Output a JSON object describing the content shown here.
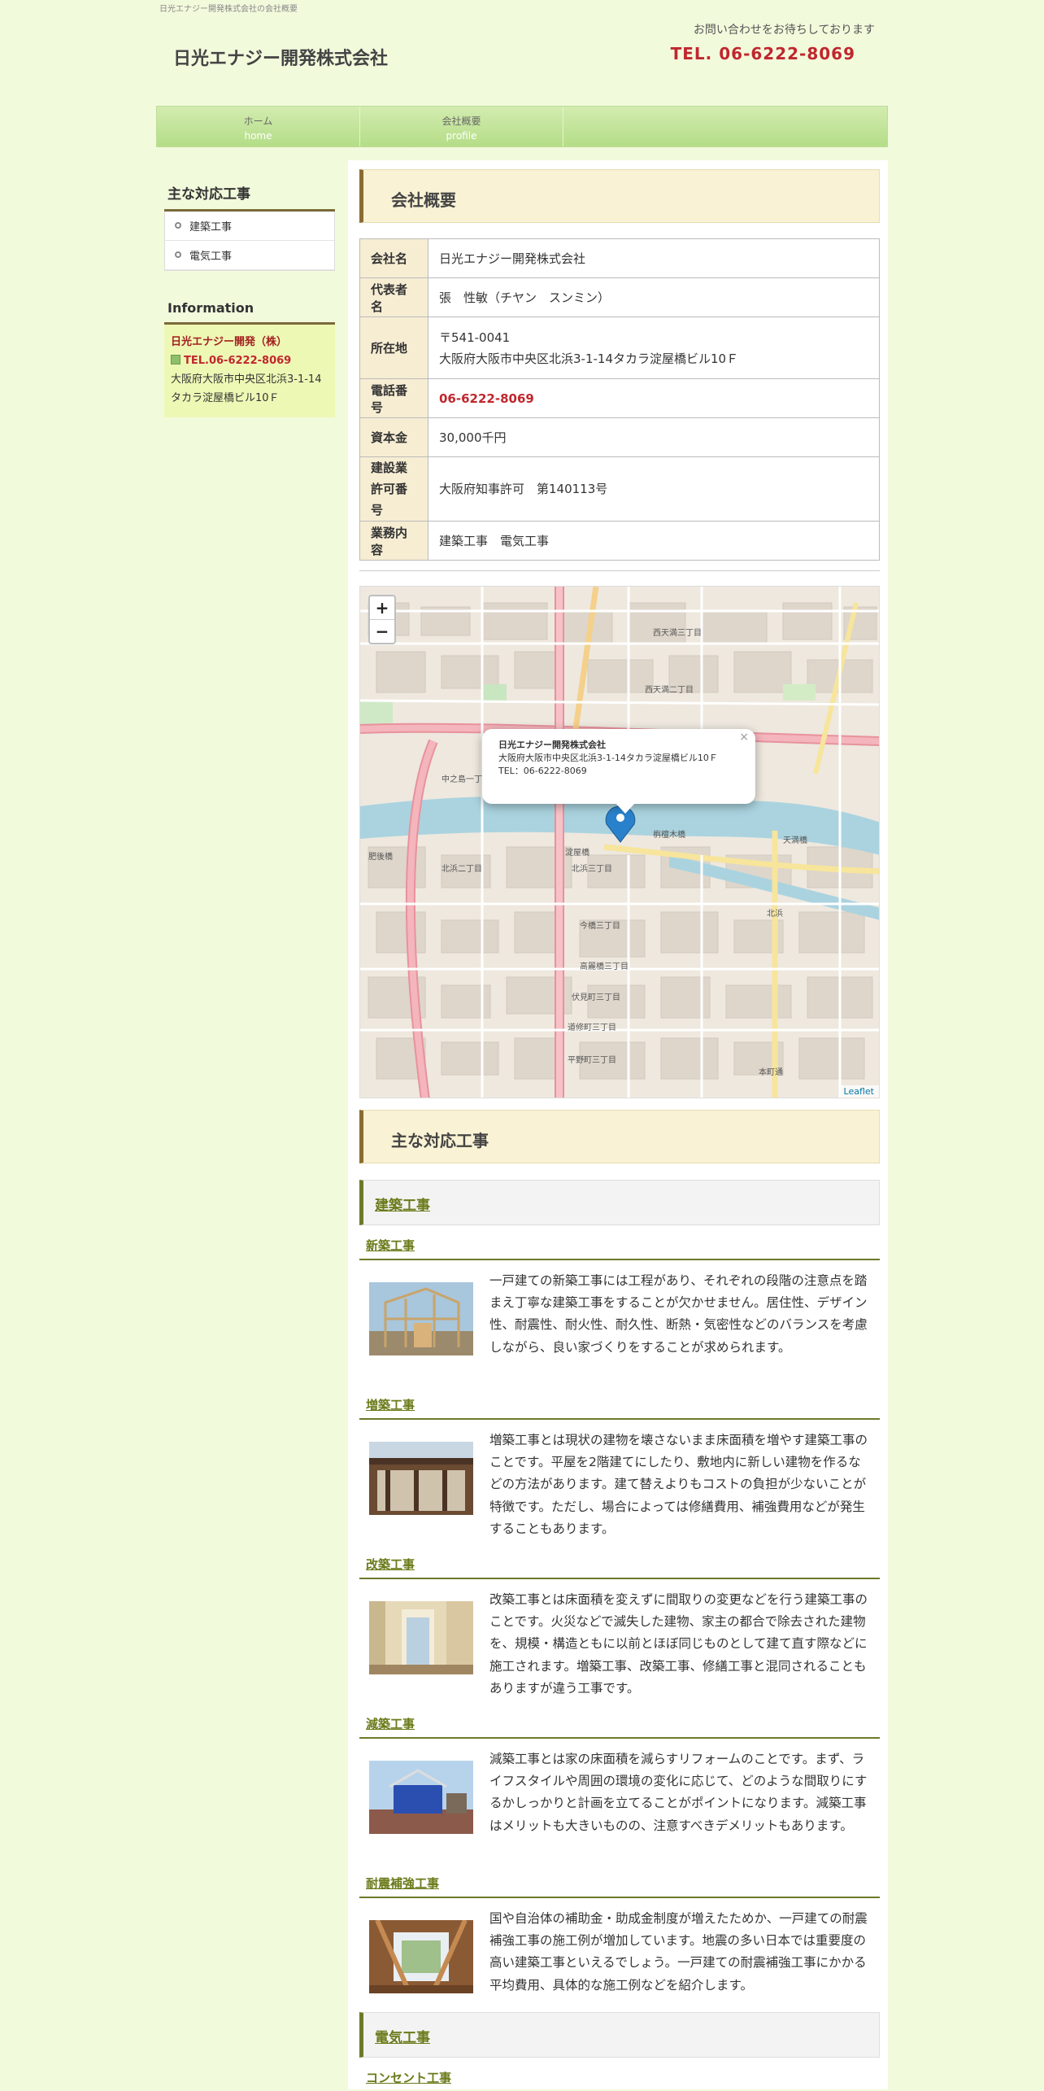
{
  "header": {
    "tagline": "日光エナジー開発株式会社の会社概要",
    "logo": "日光エナジー開発株式会社",
    "contact_message": "お問い合わせをお待ちしております",
    "tel": "TEL. 06-6222-8069"
  },
  "nav": [
    {
      "label": "ホーム",
      "sub": "home"
    },
    {
      "label": "会社概要",
      "sub": "profile"
    }
  ],
  "sidebar": {
    "menu_title": "主な対応工事",
    "menu": [
      "建築工事",
      "電気工事"
    ],
    "info_title": "Information",
    "info": {
      "company": "日光エナジー開発（株）",
      "tel": "TEL.06-6222-8069",
      "address1": "大阪府大阪市中央区北浜3-1-14",
      "address2": "タカラ淀屋橋ビル10Ｆ"
    }
  },
  "main": {
    "heading": "会社概要",
    "profile": [
      {
        "label": "会社名",
        "value": "日光エナジー開発株式会社"
      },
      {
        "label": "代表者名",
        "value": "張　性敏（チヤン　スンミン）"
      },
      {
        "label": "所在地",
        "value": "〒541-0041",
        "value2": "大阪府大阪市中央区北浜3-1-14タカラ淀屋橋ビル10Ｆ"
      },
      {
        "label": "電話番号",
        "value": "06-6222-8069"
      },
      {
        "label": "資本金",
        "value": "30,000千円"
      },
      {
        "label": "建設業許可番号",
        "value": "大阪府知事許可　第140113号"
      },
      {
        "label": "業務内容",
        "value": "建築工事　電気工事"
      }
    ],
    "map": {
      "zoom_in": "+",
      "zoom_out": "−",
      "close": "×",
      "popup_title": "日光エナジー開発株式会社",
      "popup_address": "大阪府大阪市中央区北浜3-1-14タカラ淀屋橋ビル10Ｆ",
      "popup_tel": "TEL：06-6222-8069",
      "attribution": "Leaflet",
      "labels": [
        "北浜二丁目",
        "北浜三丁目",
        "今橋三丁目",
        "高麗橋三丁目",
        "伏見町三丁目",
        "道修町三丁目",
        "平野町三丁目",
        "淀屋橋",
        "栴檀木橋",
        "中之島一丁目",
        "西天満二丁目",
        "西天満三丁目",
        "天満橋",
        "北浜",
        "肥後橋",
        "本町通"
      ]
    },
    "works_heading": "主な対応工事",
    "category1": "建築工事",
    "works": [
      {
        "title": "新築工事",
        "text": "一戸建ての新築工事には工程があり、それぞれの段階の注意点を踏まえ丁寧な建築工事をすることが欠かせません。居住性、デザイン性、耐震性、耐火性、耐久性、断熱・気密性などのバランスを考慮しながら、良い家づくりをすることが求められます。"
      },
      {
        "title": "増築工事",
        "text": "増築工事とは現状の建物を壊さないまま床面積を増やす建築工事のことです。平屋を2階建てにしたり、敷地内に新しい建物を作るなどの方法があります。建て替えよりもコストの負担が少ないことが特徴です。ただし、場合によっては修繕費用、補強費用などが発生することもあります。"
      },
      {
        "title": "改築工事",
        "text": "改築工事とは床面積を変えずに間取りの変更などを行う建築工事のことです。火災などで滅失した建物、家主の都合で除去された建物を、規模・構造ともに以前とほぼ同じものとして建て直す際などに施工されます。増築工事、改築工事、修繕工事と混同されることもありますが違う工事です。"
      },
      {
        "title": "減築工事",
        "text": "減築工事とは家の床面積を減らすリフォームのことです。まず、ライフスタイルや周囲の環境の変化に応じて、どのような間取りにするかしっかりと計画を立てることがポイントになります。減築工事はメリットも大きいものの、注意すべきデメリットもあります。"
      },
      {
        "title": "耐震補強工事",
        "text": "国や自治体の補助金・助成金制度が増えたためか、一戸建ての耐震補強工事の施工例が増加しています。地震の多い日本では重要度の高い建築工事といえるでしょう。一戸建ての耐震補強工事にかかる平均費用、具体的な施工例などを紹介します。"
      }
    ],
    "category2": "電気工事",
    "works2_first": "コンセント工事"
  },
  "colors": {
    "accent_red": "#c0272d",
    "page_bg": "#f2fadc",
    "nav_green": "#b4dd87",
    "heading_border": "#8c6b30",
    "link_olive": "#6b7a1a"
  }
}
